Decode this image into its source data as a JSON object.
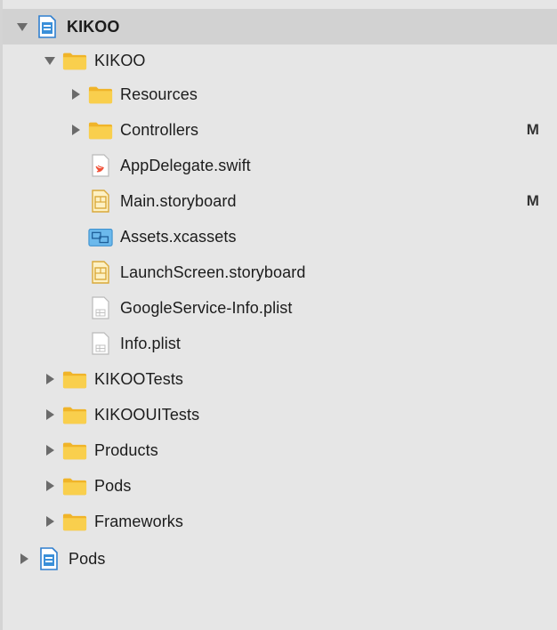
{
  "colors": {
    "folder": "#f7c948",
    "folder_tab": "#f0b429",
    "project_blue": "#3a8fd9",
    "selection": "#d2d2d2",
    "text": "#1c1c1c"
  },
  "tree": [
    {
      "label": "KIKOO",
      "icon": "project-icon",
      "expanded": true
    },
    {
      "label": "KIKOO",
      "icon": "folder-icon",
      "expanded": true
    },
    {
      "label": "Resources",
      "icon": "folder-icon",
      "expanded": false,
      "badge": ""
    },
    {
      "label": "Controllers",
      "icon": "folder-icon",
      "expanded": false,
      "badge": "M"
    },
    {
      "label": "AppDelegate.swift",
      "icon": "swift-file-icon"
    },
    {
      "label": "Main.storyboard",
      "icon": "storyboard-file-icon",
      "badge": "M"
    },
    {
      "label": "Assets.xcassets",
      "icon": "asset-catalog-icon"
    },
    {
      "label": "LaunchScreen.storyboard",
      "icon": "storyboard-file-icon"
    },
    {
      "label": "GoogleService-Info.plist",
      "icon": "plist-file-icon"
    },
    {
      "label": "Info.plist",
      "icon": "plist-file-icon"
    },
    {
      "label": "KIKOOTests",
      "icon": "folder-icon",
      "expanded": false
    },
    {
      "label": "KIKOOUITests",
      "icon": "folder-icon",
      "expanded": false
    },
    {
      "label": "Products",
      "icon": "folder-icon",
      "expanded": false
    },
    {
      "label": "Pods",
      "icon": "folder-icon",
      "expanded": false
    },
    {
      "label": "Frameworks",
      "icon": "folder-icon",
      "expanded": false
    },
    {
      "label": "Pods",
      "icon": "project-icon",
      "expanded": false
    }
  ]
}
